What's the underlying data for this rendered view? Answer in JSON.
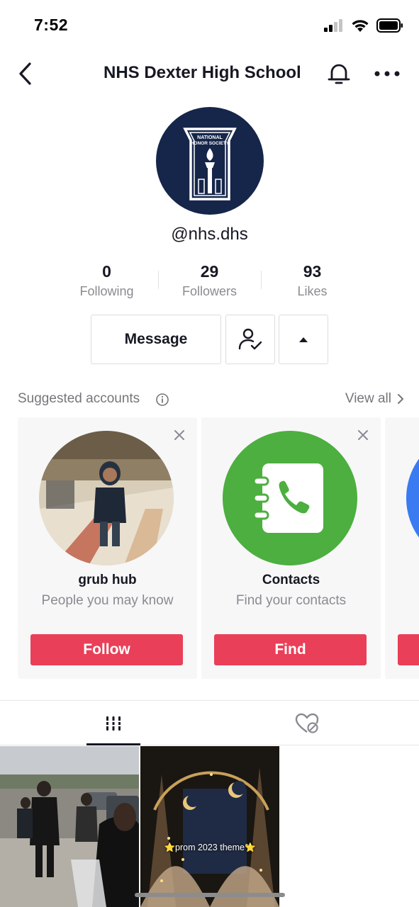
{
  "status_bar": {
    "time": "7:52"
  },
  "nav": {
    "title": "NHS Dexter High School",
    "back_icon": "chevron-left-icon",
    "bell_icon": "bell-icon",
    "more_icon": "more-horizontal-icon"
  },
  "profile": {
    "avatar_text_line1": "NATIONAL",
    "avatar_text_line2": "HONOR SOCIETY",
    "username": "@nhs.dhs",
    "stats": [
      {
        "value": "0",
        "label": "Following"
      },
      {
        "value": "29",
        "label": "Followers"
      },
      {
        "value": "93",
        "label": "Likes"
      }
    ]
  },
  "actions": {
    "message_label": "Message"
  },
  "suggested": {
    "title": "Suggested accounts",
    "view_all": "View all",
    "cards": [
      {
        "name": "grub hub",
        "subtitle": "People you may know",
        "button": "Follow"
      },
      {
        "name": "Contacts",
        "subtitle": "Find your contacts",
        "button": "Find"
      }
    ]
  },
  "videos": [
    {
      "caption": ""
    },
    {
      "caption": "⭐prom 2023 theme⭐"
    }
  ],
  "colors": {
    "accent": "#ea3f58",
    "contacts_green": "#4caf3f",
    "avatar_navy": "#16264a",
    "text_primary": "#161823",
    "text_secondary": "#8a8b91"
  }
}
